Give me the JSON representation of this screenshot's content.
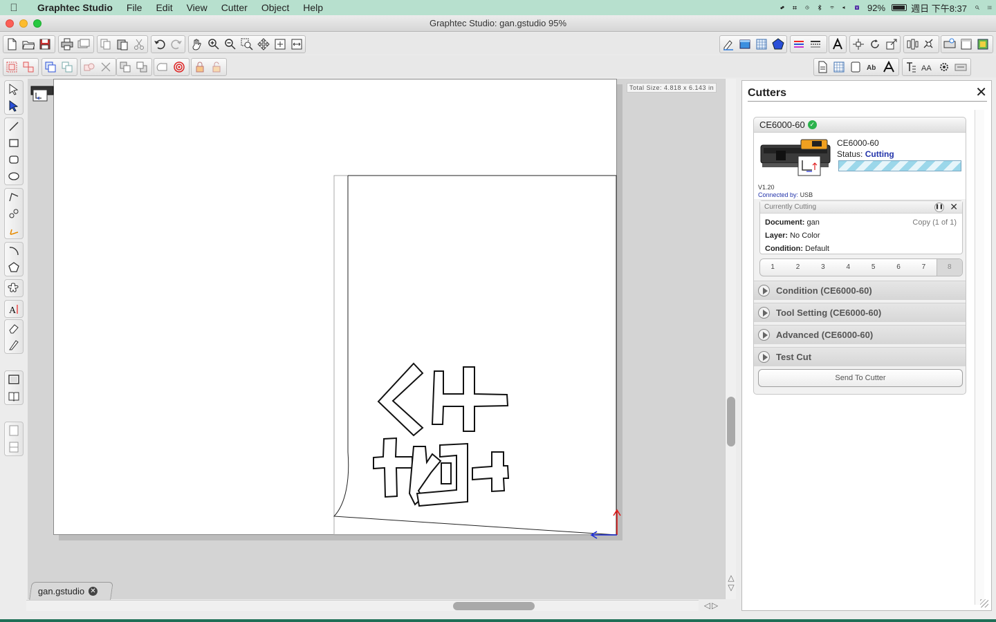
{
  "menubar": {
    "app_name": "Graphtec Studio",
    "items": [
      "File",
      "Edit",
      "View",
      "Cutter",
      "Object",
      "Help"
    ],
    "battery": "92%",
    "clock": "週日 下午8:37"
  },
  "window": {
    "title": "Graphtec Studio: gan.gstudio 95%"
  },
  "canvas": {
    "total_size": "Total Size: 4.818 x 6.143 in"
  },
  "document_tab": {
    "label": "gan.gstudio"
  },
  "cutters_panel": {
    "title": "Cutters",
    "cutter": {
      "name": "CE6000-60",
      "model": "CE6000-60",
      "status_label": "Status:",
      "status_value": "Cutting",
      "version": "V1.20",
      "connected_label": "Connected by:",
      "connected_value": "USB"
    },
    "current": {
      "heading": "Currently Cutting",
      "document_label": "Document:",
      "document_value": "gan",
      "copy_info": "Copy (1 of 1)",
      "layer_label": "Layer:",
      "layer_value": "No Color",
      "condition_label": "Condition:",
      "condition_value": "Default"
    },
    "pages": [
      "1",
      "2",
      "3",
      "4",
      "5",
      "6",
      "7",
      "8"
    ],
    "sections": [
      "Condition (CE6000-60)",
      "Tool Setting (CE6000-60)",
      "Advanced (CE6000-60)",
      "Test Cut"
    ],
    "send_button": "Send To Cutter"
  },
  "colors": {
    "menubar_bg": "#b7e0ce",
    "status_text": "#2233aa",
    "progress_stripe": "#9bd7ea",
    "origin_x_axis": "#1a2bd8",
    "origin_y_axis": "#e01b1b"
  }
}
